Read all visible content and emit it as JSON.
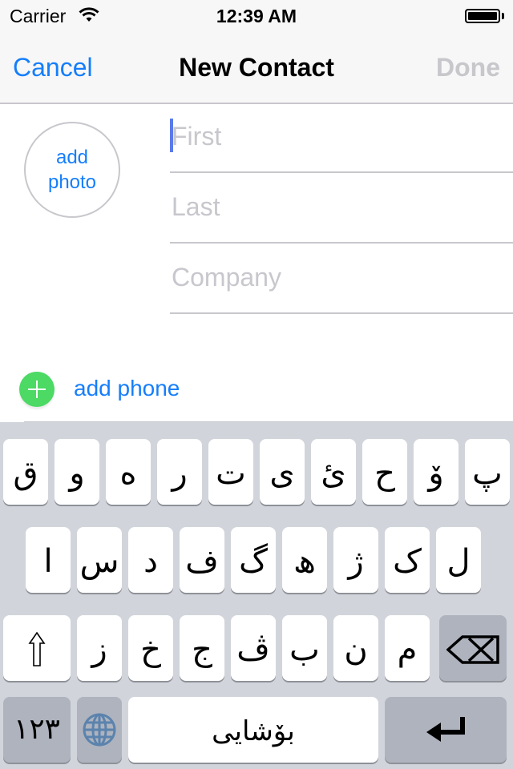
{
  "status_bar": {
    "carrier": "Carrier",
    "time": "12:39 AM",
    "wifi_icon": "wifi-icon",
    "battery_icon": "battery-full-icon"
  },
  "nav": {
    "cancel_label": "Cancel",
    "title": "New Contact",
    "done_label": "Done",
    "accent_color": "#157efb",
    "disabled_color": "#c7c7cc"
  },
  "form": {
    "add_photo_label": "add\nphoto",
    "fields": [
      {
        "name": "first",
        "placeholder": "First",
        "value": ""
      },
      {
        "name": "last",
        "placeholder": "Last",
        "value": ""
      },
      {
        "name": "company",
        "placeholder": "Company",
        "value": ""
      }
    ],
    "add_phone_label": "add phone",
    "add_phone_icon": "plus-circle-icon",
    "add_phone_color": "#4cd964"
  },
  "keyboard": {
    "row1": [
      "ق",
      "و",
      "ه",
      "ر",
      "ت",
      "ی",
      "ئ",
      "ح",
      "ۆ",
      "پ"
    ],
    "row2": [
      "ا",
      "س",
      "د",
      "ف",
      "گ",
      "ھ",
      "ژ",
      "ک",
      "ل"
    ],
    "row3": [
      "ز",
      "خ",
      "ج",
      "ڤ",
      "ب",
      "ن",
      "م"
    ],
    "shift_icon": "shift-arrow-icon",
    "backspace_icon": "backspace-icon",
    "numbers_label": "١٢٣",
    "globe_icon": "globe-icon",
    "space_label": "بۆشایی",
    "return_icon": "return-arrow-icon"
  }
}
